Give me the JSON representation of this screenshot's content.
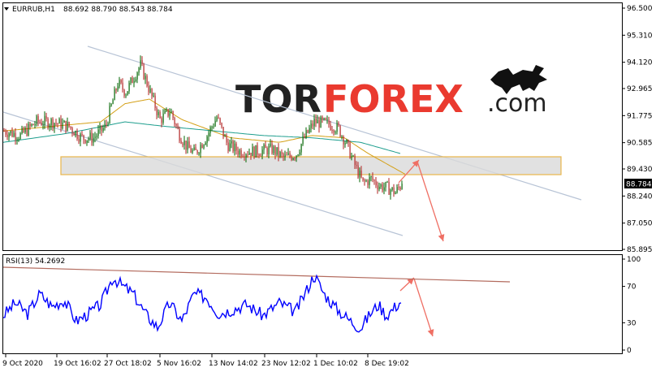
{
  "header": {
    "symbol_timeframe": "EURRUB,H1",
    "ohlc": "88.692 88.790 88.543 88.784"
  },
  "watermark": {
    "brand_part1": "TOR",
    "brand_part2": "FOREX",
    "brand_suffix": ".com",
    "icon": "bull-icon"
  },
  "colors": {
    "background": "#ffffff",
    "grid_border": "#000000",
    "bull_candle": "#006400",
    "bear_candle": "#b22222",
    "ma_fast": "#d4a017",
    "ma_slow": "#1e9e8e",
    "channel": "#b8c4d6",
    "zone_fill": "#d9d9d9",
    "zone_border": "#e8b64a",
    "arrows": "#ef6f64",
    "rsi_line": "#0000ff",
    "rsi_trend": "#b36b5e"
  },
  "price_axis": {
    "ticks": [
      "96.500",
      "95.310",
      "94.120",
      "92.965",
      "91.775",
      "90.585",
      "89.430",
      "88.240",
      "87.050",
      "85.895"
    ],
    "current_price": "88.784"
  },
  "rsi": {
    "label": "RSI(13) 54.2692",
    "ticks": [
      "100",
      "70",
      "30",
      "0"
    ]
  },
  "time_axis": {
    "labels": [
      "9 Oct 2020",
      "19 Oct 16:02",
      "27 Oct 18:02",
      "5 Nov 16:02",
      "13 Nov 14:02",
      "23 Nov 12:02",
      "1 Dec 10:02",
      "8 Dec 19:02"
    ]
  },
  "chart_data": {
    "type": "candlestick",
    "instrument": "EURRUB",
    "timeframe": "H1",
    "ylim": [
      85.895,
      96.5
    ],
    "anchors": [
      [
        0,
        91.1
      ],
      [
        20,
        90.9
      ],
      [
        40,
        91.5
      ],
      [
        60,
        91.5
      ],
      [
        80,
        91.3
      ],
      [
        95,
        90.8
      ],
      [
        110,
        90.8
      ],
      [
        125,
        91.3
      ],
      [
        140,
        93.2
      ],
      [
        150,
        92.8
      ],
      [
        160,
        93.5
      ],
      [
        168,
        94.0
      ],
      [
        178,
        93.0
      ],
      [
        192,
        91.6
      ],
      [
        205,
        92.0
      ],
      [
        215,
        91.0
      ],
      [
        225,
        90.4
      ],
      [
        235,
        90.1
      ],
      [
        250,
        90.9
      ],
      [
        262,
        91.7
      ],
      [
        275,
        90.5
      ],
      [
        290,
        90.2
      ],
      [
        310,
        90.2
      ],
      [
        330,
        90.3
      ],
      [
        345,
        89.9
      ],
      [
        360,
        90.1
      ],
      [
        370,
        90.8
      ],
      [
        382,
        91.5
      ],
      [
        400,
        91.4
      ],
      [
        412,
        91.2
      ],
      [
        422,
        90.5
      ],
      [
        432,
        89.6
      ],
      [
        442,
        88.8
      ],
      [
        452,
        89.0
      ],
      [
        462,
        88.7
      ],
      [
        472,
        88.6
      ],
      [
        482,
        88.4
      ],
      [
        490,
        88.78
      ]
    ],
    "moving_averages": [
      {
        "color_key": "ma_fast",
        "anchors": [
          [
            0,
            91.1
          ],
          [
            60,
            91.3
          ],
          [
            120,
            91.5
          ],
          [
            150,
            92.3
          ],
          [
            180,
            92.5
          ],
          [
            220,
            91.6
          ],
          [
            280,
            90.8
          ],
          [
            340,
            90.6
          ],
          [
            380,
            90.9
          ],
          [
            420,
            90.8
          ],
          [
            450,
            90.1
          ],
          [
            495,
            89.2
          ]
        ]
      },
      {
        "color_key": "ma_slow",
        "anchors": [
          [
            0,
            90.6
          ],
          [
            80,
            91.0
          ],
          [
            150,
            91.5
          ],
          [
            200,
            91.3
          ],
          [
            260,
            91.1
          ],
          [
            320,
            90.9
          ],
          [
            380,
            90.8
          ],
          [
            440,
            90.6
          ],
          [
            490,
            90.1
          ]
        ]
      }
    ],
    "rsi": {
      "value": 54.2692,
      "ylim": [
        0,
        100
      ],
      "levels": [
        70,
        30
      ],
      "anchors": [
        [
          0,
          38
        ],
        [
          15,
          52
        ],
        [
          30,
          40
        ],
        [
          45,
          62
        ],
        [
          60,
          48
        ],
        [
          75,
          55
        ],
        [
          90,
          32
        ],
        [
          105,
          40
        ],
        [
          120,
          50
        ],
        [
          135,
          80
        ],
        [
          145,
          72
        ],
        [
          160,
          62
        ],
        [
          175,
          40
        ],
        [
          190,
          25
        ],
        [
          205,
          52
        ],
        [
          220,
          32
        ],
        [
          235,
          62
        ],
        [
          250,
          58
        ],
        [
          265,
          40
        ],
        [
          280,
          44
        ],
        [
          300,
          50
        ],
        [
          320,
          38
        ],
        [
          340,
          52
        ],
        [
          360,
          42
        ],
        [
          375,
          68
        ],
        [
          383,
          83
        ],
        [
          395,
          62
        ],
        [
          410,
          46
        ],
        [
          425,
          34
        ],
        [
          440,
          24
        ],
        [
          452,
          40
        ],
        [
          462,
          50
        ],
        [
          472,
          38
        ],
        [
          482,
          47
        ],
        [
          490,
          54
        ]
      ]
    }
  }
}
